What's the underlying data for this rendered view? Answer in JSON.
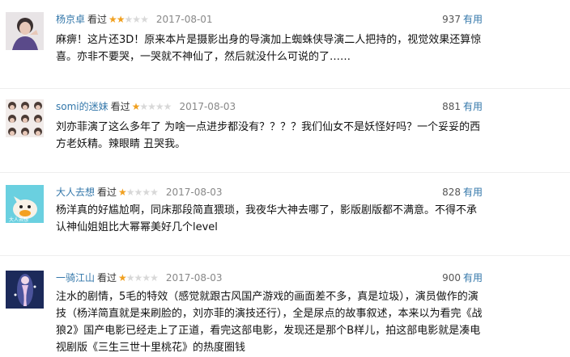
{
  "comments": [
    {
      "username": "杨京卓",
      "status": "看过",
      "rating": 2,
      "rating_max": 5,
      "date": "2017-08-01",
      "votes": "937",
      "useful_label": "有用",
      "text": "麻痹！这片还3D！原来本片是摄影出身的导演加上蜘蛛侠导演二人把持的，视觉效果还算惊喜。亦非不要哭，一哭就不神仙了，然后就没什么可说的了……"
    },
    {
      "username": "somi的迷妹",
      "status": "看过",
      "rating": 1,
      "rating_max": 5,
      "date": "2017-08-03",
      "votes": "881",
      "useful_label": "有用",
      "text": "刘亦菲演了这么多年了 为啥一点进步都没有？？？？我们仙女不是妖怪好吗？一个妥妥的西方老妖精。辣眼睛 丑哭我。"
    },
    {
      "username": "大人去想",
      "status": "看过",
      "rating": 1,
      "rating_max": 5,
      "date": "2017-08-03",
      "votes": "828",
      "useful_label": "有用",
      "text": "杨洋真的好尴尬啊，同床那段简直猥琐，我夜华大神去哪了，影版剧版都不满意。不得不承认神仙姐姐比大幂幂美好几个level"
    },
    {
      "username": "一骑江山",
      "status": "看过",
      "rating": 1,
      "rating_max": 5,
      "date": "2017-08-03",
      "votes": "900",
      "useful_label": "有用",
      "text": "注水的剧情，5毛的特效（感觉就跟古风国产游戏的画面差不多，真是垃圾），演员做作的演技（杨洋简直就是来刷脸的，刘亦菲的演技还行），全是尿点的故事叙述，本来以为看完《战狼2》国产电影已经走上了正道，看完这部电影，发现还是那个B样儿，拍这部电影就是凑电视剧版《三生三世十里桃花》的热度圈钱"
    }
  ],
  "colors": {
    "link": "#3377aa",
    "star_on": "#f0a020",
    "star_off": "#d8d8d8",
    "date": "#888888"
  }
}
